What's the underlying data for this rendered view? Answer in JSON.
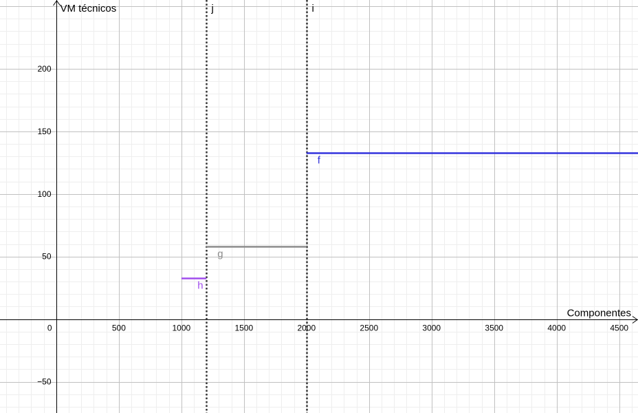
{
  "chart_data": {
    "type": "line",
    "xlabel": "Componentes",
    "ylabel": "VM técnicos",
    "xlim": [
      -450,
      4650
    ],
    "ylim": [
      -75,
      255
    ],
    "grid": true,
    "major_grid_x": 500,
    "major_grid_y": 50,
    "minor_grid_x": 100,
    "minor_grid_y": 10,
    "x_ticks": [
      {
        "value": 0,
        "label": "0"
      },
      {
        "value": 500,
        "label": "500"
      },
      {
        "value": 1000,
        "label": "1000"
      },
      {
        "value": 1500,
        "label": "1500"
      },
      {
        "value": 2000,
        "label": "2000"
      },
      {
        "value": 2500,
        "label": "2500"
      },
      {
        "value": 3000,
        "label": "3000"
      },
      {
        "value": 3500,
        "label": "3500"
      },
      {
        "value": 4000,
        "label": "4000"
      },
      {
        "value": 4500,
        "label": "4500"
      }
    ],
    "y_ticks": [
      {
        "value": -50,
        "label": "−50"
      },
      {
        "value": 50,
        "label": "50"
      },
      {
        "value": 100,
        "label": "100"
      },
      {
        "value": 150,
        "label": "150"
      },
      {
        "value": 200,
        "label": "200"
      }
    ],
    "segments": [
      {
        "name": "h",
        "x1": 1000,
        "x2": 1200,
        "y": 33,
        "color": "#a04ded"
      },
      {
        "name": "g",
        "x1": 1200,
        "x2": 2000,
        "y": 58,
        "color": "#8c8c8c"
      },
      {
        "name": "f",
        "x1": 2000,
        "x2": 4650,
        "y": 133,
        "color": "#3333dd"
      }
    ],
    "vertical_lines": [
      {
        "name": "j",
        "x": 1200,
        "color": "#333333"
      },
      {
        "name": "i",
        "x": 2000,
        "color": "#333333"
      }
    ]
  }
}
